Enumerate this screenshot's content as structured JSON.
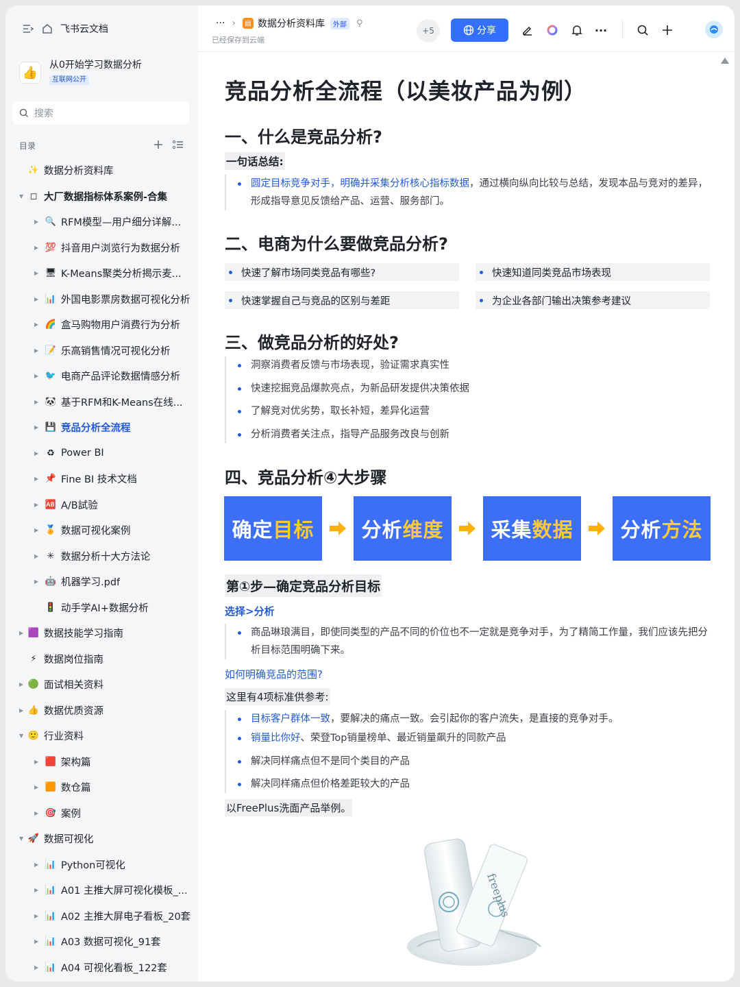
{
  "app": {
    "home_label": "飞书云文档"
  },
  "workspace": {
    "name": "从0开始学习数据分析",
    "tag": "互联网公开"
  },
  "search": {
    "placeholder": "搜索"
  },
  "toc": {
    "label": "目录"
  },
  "nav": [
    {
      "label": "数据分析资料库",
      "icon": "sparkle-icon",
      "emoji": "✨",
      "level": 0,
      "arrow": "",
      "style": ""
    },
    {
      "label": "大厂数据指标体系案例-合集",
      "icon": "square-icon",
      "emoji": "◻",
      "level": 0,
      "arrow": "▼",
      "style": "bold"
    },
    {
      "label": "RFM模型—用户细分详解...",
      "icon": "magnifier-icon",
      "emoji": "🔍",
      "level": 1,
      "arrow": "▶",
      "style": ""
    },
    {
      "label": "抖音用户浏览行为数据分析",
      "icon": "hundred-icon",
      "emoji": "💯",
      "level": 1,
      "arrow": "▶",
      "style": ""
    },
    {
      "label": "K-Means聚类分析揭示麦...",
      "icon": "monitor-icon",
      "emoji": "🖥",
      "level": 1,
      "arrow": "▶",
      "style": ""
    },
    {
      "label": "外国电影票房数据可视化分析",
      "icon": "bar-chart-icon",
      "emoji": "📊",
      "level": 1,
      "arrow": "▶",
      "style": ""
    },
    {
      "label": "盒马购物用户消费行为分析",
      "icon": "rainbow-icon",
      "emoji": "🌈",
      "level": 1,
      "arrow": "▶",
      "style": ""
    },
    {
      "label": "乐高销售情况可视化分析",
      "icon": "memo-icon",
      "emoji": "📝",
      "level": 1,
      "arrow": "▶",
      "style": ""
    },
    {
      "label": "电商产品评论数据情感分析",
      "icon": "bird-icon",
      "emoji": "🐦",
      "level": 1,
      "arrow": "▶",
      "style": ""
    },
    {
      "label": "基于RFM和K-Means在线...",
      "icon": "panda-icon",
      "emoji": "🐼",
      "level": 1,
      "arrow": "▶",
      "style": ""
    },
    {
      "label": "竞品分析全流程",
      "icon": "save-icon",
      "emoji": "💾",
      "level": 1,
      "arrow": "▶",
      "style": "active"
    },
    {
      "label": "Power BI",
      "icon": "recycle-icon",
      "emoji": "♻",
      "level": 1,
      "arrow": "▶",
      "style": ""
    },
    {
      "label": "Fine BI 技术文档",
      "icon": "pin-icon",
      "emoji": "📌",
      "level": 1,
      "arrow": "▶",
      "style": ""
    },
    {
      "label": "A/B試验",
      "icon": "ab-icon",
      "emoji": "🆎",
      "level": 1,
      "arrow": "▶",
      "style": ""
    },
    {
      "label": "数据可视化案例",
      "icon": "medal-icon",
      "emoji": "🏅",
      "level": 1,
      "arrow": "▶",
      "style": ""
    },
    {
      "label": "数据分析十大方法论",
      "icon": "star-icon",
      "emoji": "✳",
      "level": 1,
      "arrow": "▶",
      "style": ""
    },
    {
      "label": "机器学习.pdf",
      "icon": "robot-icon",
      "emoji": "🤖",
      "level": 1,
      "arrow": "▶",
      "style": ""
    },
    {
      "label": "动手学AI+数据分析",
      "icon": "traffic-light-icon",
      "emoji": "🚦",
      "level": 1,
      "arrow": "",
      "style": ""
    },
    {
      "label": "数据技能学习指南",
      "icon": "sheet-icon",
      "emoji": "🟪",
      "level": 0,
      "arrow": "▶",
      "style": ""
    },
    {
      "label": "数据岗位指南",
      "icon": "bolt-icon",
      "emoji": "⚡",
      "level": 0,
      "arrow": "",
      "style": ""
    },
    {
      "label": "面试相关资料",
      "icon": "clock-icon",
      "emoji": "🟢",
      "level": 0,
      "arrow": "▶",
      "style": ""
    },
    {
      "label": "数据优质资源",
      "icon": "hand-icon",
      "emoji": "👍",
      "level": 0,
      "arrow": "▶",
      "style": ""
    },
    {
      "label": "行业资料",
      "icon": "face-icon",
      "emoji": "🙂",
      "level": 0,
      "arrow": "▼",
      "style": ""
    },
    {
      "label": "架构篇",
      "icon": "link-icon",
      "emoji": "🟥",
      "level": 1,
      "arrow": "▶",
      "style": ""
    },
    {
      "label": "数仓篇",
      "icon": "box-icon",
      "emoji": "🟧",
      "level": 1,
      "arrow": "▶",
      "style": ""
    },
    {
      "label": "案例",
      "icon": "target-icon",
      "emoji": "🎯",
      "level": 1,
      "arrow": "▶",
      "style": ""
    },
    {
      "label": "数据可视化",
      "icon": "rocket-icon",
      "emoji": "🚀",
      "level": 0,
      "arrow": "▼",
      "style": ""
    },
    {
      "label": "Python可视化",
      "icon": "bar-chart-icon",
      "emoji": "📊",
      "level": 1,
      "arrow": "▶",
      "style": ""
    },
    {
      "label": "A01 主推大屏可视化模板_...",
      "icon": "bar-chart-icon",
      "emoji": "📊",
      "level": 1,
      "arrow": "▶",
      "style": ""
    },
    {
      "label": "A02 主推大屏电子看板_20套",
      "icon": "bar-chart-icon",
      "emoji": "📊",
      "level": 1,
      "arrow": "▶",
      "style": ""
    },
    {
      "label": "A03 数据可视化_91套",
      "icon": "bar-chart-icon",
      "emoji": "📊",
      "level": 1,
      "arrow": "▶",
      "style": ""
    },
    {
      "label": "A04 可视化看板_122套",
      "icon": "bar-chart-icon",
      "emoji": "📊",
      "level": 1,
      "arrow": "▶",
      "style": ""
    }
  ],
  "topbar": {
    "more": "···",
    "breadcrumb": "数据分析资料库",
    "external_tag": "外部",
    "saved_text": "已经保存到云端",
    "collaborators": "+5",
    "share_label": "分享",
    "overflow": "···"
  },
  "doc": {
    "title": "竞品分析全流程（以美妆产品为例）",
    "s1_title": "一、什么是竞品分析?",
    "s1_label": "一句话总结:",
    "s1_link": "圆定目标竞争对手，明确并采集分析核心指标数据",
    "s1_text": "，通过横向纵向比较与总结，发现本品与竞对的差异，形成指导意见反馈给产品、运营、服务部门。",
    "s2_title": "二、电商为什么要做竞品分析?",
    "s2_items": [
      "快速了解市场同类竞品有哪些?",
      "快速知道同类竞品市场表现",
      "快速掌握自己与竞品的区别与差距",
      "为企业各部门输出决策参考建议"
    ],
    "s3_title": "三、做竞品分析的好处?",
    "s3_items": [
      "洞察消费者反馈与市场表现，验证需求真实性",
      "快速挖掘竞品爆款亮点，为新品研发提供决策依据",
      "了解竞对优劣势，取长补短，差异化运营",
      "分析消费者关注点，指导产品服务改良与创新"
    ],
    "s4_title": "四、竞品分析④大步骤",
    "steps": [
      {
        "a": "确定",
        "b": "目标"
      },
      {
        "a": "分析",
        "b": "维度"
      },
      {
        "a": "采集",
        "b": "数据"
      },
      {
        "a": "分析",
        "b": "方法"
      }
    ],
    "step1_title": "第①步—确定竞品分析目标",
    "step1_sub": "选择>分析",
    "step1_text": "商品琳琅满目，即使同类型的产品不同的价位也不一定就是竞争对手，为了精简工作量，我们应该先把分析目标范围明确下来。",
    "range_q": "如何明确竞品的范围?",
    "criteria_label": "这里有4项标准供参考:",
    "c1_link": "目标客户群体一致",
    "c1_text": "，要解决的痛点一致。会引起你的客户流失，是直接的竞争对手。",
    "c2_link": "销量比你好",
    "c2_text": "、荣登Top销量榜单、最近销量飙升的同款产品",
    "c3": "解决同样痛点但不是同个类目的产品",
    "c4": "解决同样痛点但价格差距较大的产品",
    "example": "以FreePlus洗面产品举例。",
    "product_brand": "freeplus"
  },
  "colors": {
    "accent": "#3370ff",
    "link": "#245bdb",
    "step_bg": "#3c6ef7",
    "step_highlight": "#ffc93c",
    "arrow": "#ffb000"
  }
}
